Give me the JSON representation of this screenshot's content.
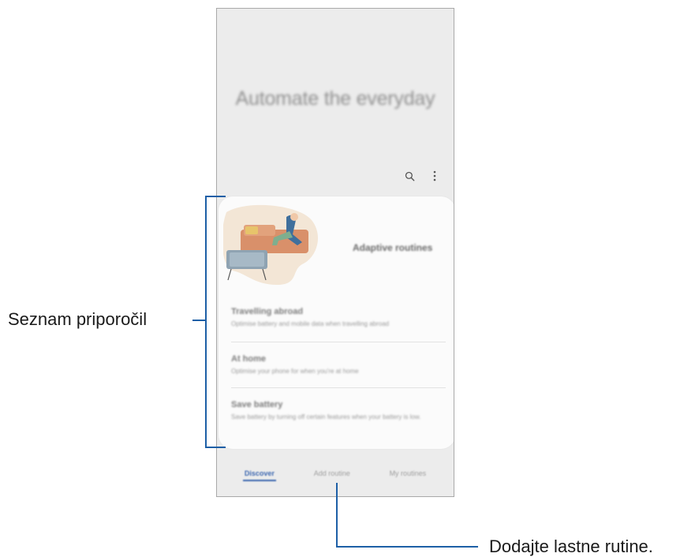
{
  "screen": {
    "hero_title": "Automate the everyday",
    "toolbar": {
      "search_icon": "search-icon",
      "more_icon": "more-vert-icon"
    },
    "card": {
      "heading": "Adaptive routines",
      "items": [
        {
          "title": "Travelling abroad",
          "desc": "Optimise battery and mobile data when travelling abroad"
        },
        {
          "title": "At home",
          "desc": "Optimise your phone for when you're at home"
        },
        {
          "title": "Save battery",
          "desc": "Save battery by turning off certain features when your battery is low."
        }
      ]
    },
    "nav": {
      "tabs": [
        {
          "label": "Discover",
          "active": true
        },
        {
          "label": "Add routine",
          "active": false
        },
        {
          "label": "My routines",
          "active": false
        }
      ]
    }
  },
  "callouts": {
    "recommendations": "Seznam priporočil",
    "add_routine": "Dodajte lastne rutine."
  },
  "colors": {
    "accent": "#3d68b0",
    "callout_line": "#1d5fa6"
  }
}
